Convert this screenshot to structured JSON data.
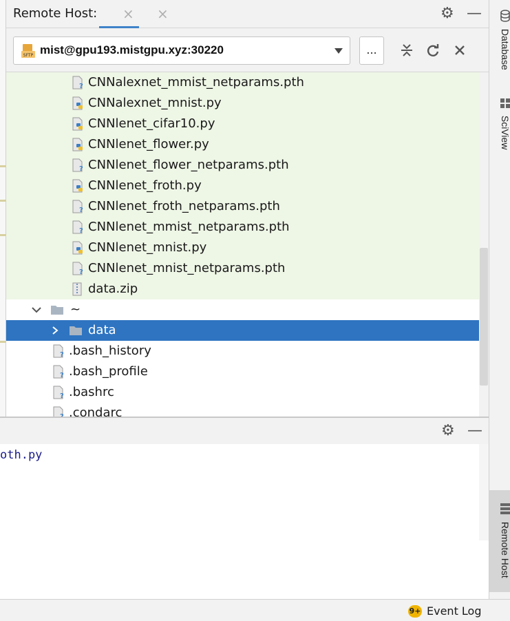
{
  "header": {
    "title": "Remote Host:",
    "tab_close": "×",
    "gear_icon": "⚙",
    "minimize_icon": "—"
  },
  "host": {
    "sftp_label": "SFTP",
    "connection": "mist@gpu193.mistgpu.xyz:30220",
    "more_label": "...",
    "collapse_icon": "collapse-all",
    "refresh_icon": "refresh",
    "close_icon": "close"
  },
  "tree": {
    "files": [
      {
        "name": "CNNalexnet_mmist_netparams.pth",
        "icon": "unknown-file-icon"
      },
      {
        "name": "CNNalexnet_mnist.py",
        "icon": "python-file-icon"
      },
      {
        "name": "CNNlenet_cifar10.py",
        "icon": "python-file-icon"
      },
      {
        "name": "CNNlenet_flower.py",
        "icon": "python-file-icon"
      },
      {
        "name": "CNNlenet_flower_netparams.pth",
        "icon": "unknown-file-icon"
      },
      {
        "name": "CNNlenet_froth.py",
        "icon": "python-file-icon"
      },
      {
        "name": "CNNlenet_froth_netparams.pth",
        "icon": "unknown-file-icon"
      },
      {
        "name": "CNNlenet_mmist_netparams.pth",
        "icon": "unknown-file-icon"
      },
      {
        "name": "CNNlenet_mnist.py",
        "icon": "python-file-icon"
      },
      {
        "name": "CNNlenet_mnist_netparams.pth",
        "icon": "unknown-file-icon"
      },
      {
        "name": "data.zip",
        "icon": "zip-file-icon"
      }
    ],
    "home_folder": "~",
    "selected_folder": "data",
    "home_files": [
      ".bash_history",
      ".bash_profile",
      ".bashrc",
      ".condarc"
    ],
    "expanded_chevron": "⌄",
    "collapsed_chevron": "›"
  },
  "editor": {
    "code_line": "oth.py"
  },
  "right_bar": {
    "database": "Database",
    "sciview": "SciView",
    "remote_host": "Remote Host"
  },
  "status": {
    "badge": "9+",
    "event_log": "Event Log"
  },
  "colors": {
    "selection": "#2e74c1",
    "tab_underline": "#4083c9",
    "modified_bg": "#eef6e6"
  }
}
